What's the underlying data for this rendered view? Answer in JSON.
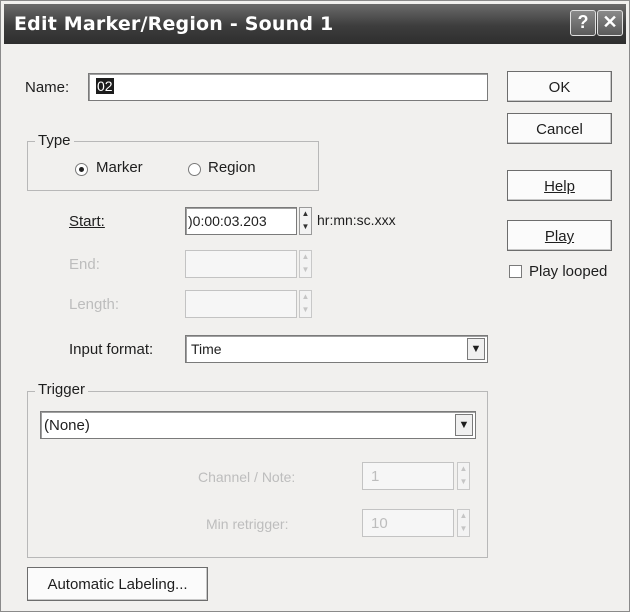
{
  "window": {
    "title": "Edit Marker/Region - Sound 1",
    "help_glyph": "?",
    "close_glyph": "✕"
  },
  "name": {
    "label": "Name:",
    "value": "02"
  },
  "buttons": {
    "ok": "OK",
    "cancel": "Cancel",
    "help": "Help",
    "play": "Play",
    "play_looped": "Play looped",
    "automatic_labeling": "Automatic Labeling..."
  },
  "type": {
    "label": "Type",
    "marker": "Marker",
    "region": "Region",
    "selected": "Marker"
  },
  "start": {
    "label": "Start:",
    "value": ")0:00:03.203",
    "format_hint": "hr:mn:sc.xxx"
  },
  "end": {
    "label": "End:",
    "value": ""
  },
  "length": {
    "label": "Length:",
    "value": ""
  },
  "input_format": {
    "label": "Input format:",
    "value": "Time"
  },
  "trigger": {
    "label": "Trigger",
    "value": "(None)",
    "channel_label": "Channel / Note:",
    "channel_value": "1",
    "min_retrigger_label": "Min retrigger:",
    "min_retrigger_value": "10"
  },
  "icons": {
    "spin": "up-down-arrows",
    "dropdown": "down-arrow"
  }
}
